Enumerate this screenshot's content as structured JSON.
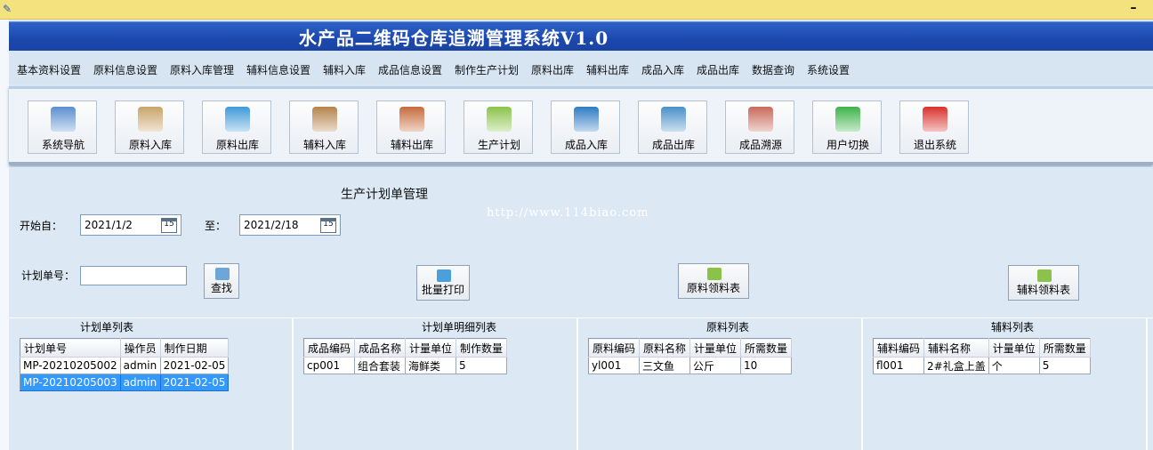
{
  "window": {
    "app_icon": "app-icon",
    "minimize_label": "–"
  },
  "header": {
    "title": "水产品二维码仓库追溯管理系统V1.0"
  },
  "menu": [
    "基本资料设置",
    "原料信息设置",
    "原料入库管理",
    "辅料信息设置",
    "辅料入库",
    "成品信息设置",
    "制作生产计划",
    "原料出库",
    "辅料出库",
    "成品入库",
    "成品出库",
    "数据查询",
    "系统设置"
  ],
  "toolbar": [
    {
      "label": "系统导航",
      "icon": "database-icon",
      "color": "#5b8fd0"
    },
    {
      "label": "原料入库",
      "icon": "box-add-icon",
      "color": "#c9a46a"
    },
    {
      "label": "原料出库",
      "icon": "printer-icon",
      "color": "#3f9ad8"
    },
    {
      "label": "辅料入库",
      "icon": "box-in-icon",
      "color": "#b4844a"
    },
    {
      "label": "辅料出库",
      "icon": "box-out-icon",
      "color": "#c76b3c"
    },
    {
      "label": "生产计划",
      "icon": "pencil-paper-icon",
      "color": "#8bc34a"
    },
    {
      "label": "成品入库",
      "icon": "window-in-icon",
      "color": "#2e7cc4"
    },
    {
      "label": "成品出库",
      "icon": "window-out-icon",
      "color": "#4a90c9"
    },
    {
      "label": "成品溯源",
      "icon": "house-icon",
      "color": "#c86a5a"
    },
    {
      "label": "用户切换",
      "icon": "refresh-icon",
      "color": "#3db34a"
    },
    {
      "label": "退出系统",
      "icon": "power-icon",
      "color": "#d9312b"
    }
  ],
  "form": {
    "section_title": "生产计划单管理",
    "watermark": "http://www.114biao.com",
    "start_label": "开始自：",
    "start_date": "2021/1/2",
    "end_label": "至：",
    "end_date": "2021/2/18",
    "calendar_day": "15",
    "plan_no_label": "计划单号：",
    "plan_no_value": "",
    "search_label": "查找",
    "batch_print_label": "批量打印",
    "raw_pick_label": "原料领料表",
    "aux_pick_label": "辅料领料表"
  },
  "panels": {
    "plan_list": {
      "title": "计划单列表",
      "columns": [
        "计划单号",
        "操作员",
        "制作日期"
      ],
      "rows": [
        [
          "MP-20210205002",
          "admin",
          "2021-02-05"
        ],
        [
          "MP-20210205003",
          "admin",
          "2021-02-05"
        ]
      ],
      "selected_row": 1
    },
    "plan_detail": {
      "title": "计划单明细列表",
      "columns": [
        "成品编码",
        "成品名称",
        "计量单位",
        "制作数量"
      ],
      "rows": [
        [
          "cp001",
          "组合套装",
          "海鲜类",
          "5"
        ]
      ]
    },
    "raw_list": {
      "title": "原料列表",
      "columns": [
        "原料编码",
        "原料名称",
        "计量单位",
        "所需数量"
      ],
      "rows": [
        [
          "yl001",
          "三文鱼",
          "公斤",
          "10"
        ]
      ]
    },
    "aux_list": {
      "title": "辅料列表",
      "columns": [
        "辅料编码",
        "辅料名称",
        "计量单位",
        "所需数量"
      ],
      "rows": [
        [
          "fl001",
          "2#礼盒上盖",
          "个",
          "5"
        ]
      ]
    }
  }
}
